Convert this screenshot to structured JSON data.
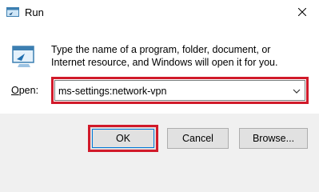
{
  "window": {
    "title": "Run"
  },
  "description": "Type the name of a program, folder, document, or Internet resource, and Windows will open it for you.",
  "open_field": {
    "label_underlined": "O",
    "label_rest": "pen:",
    "value": "ms-settings:network-vpn"
  },
  "buttons": {
    "ok": "OK",
    "cancel": "Cancel",
    "browse": "Browse..."
  },
  "colors": {
    "highlight": "#d11a2a",
    "accent": "#0078d7",
    "footer_bg": "#f0f0f0"
  },
  "icons": {
    "title": "run-app-icon",
    "close": "close-icon",
    "main": "run-app-icon",
    "dropdown": "chevron-down-icon"
  }
}
